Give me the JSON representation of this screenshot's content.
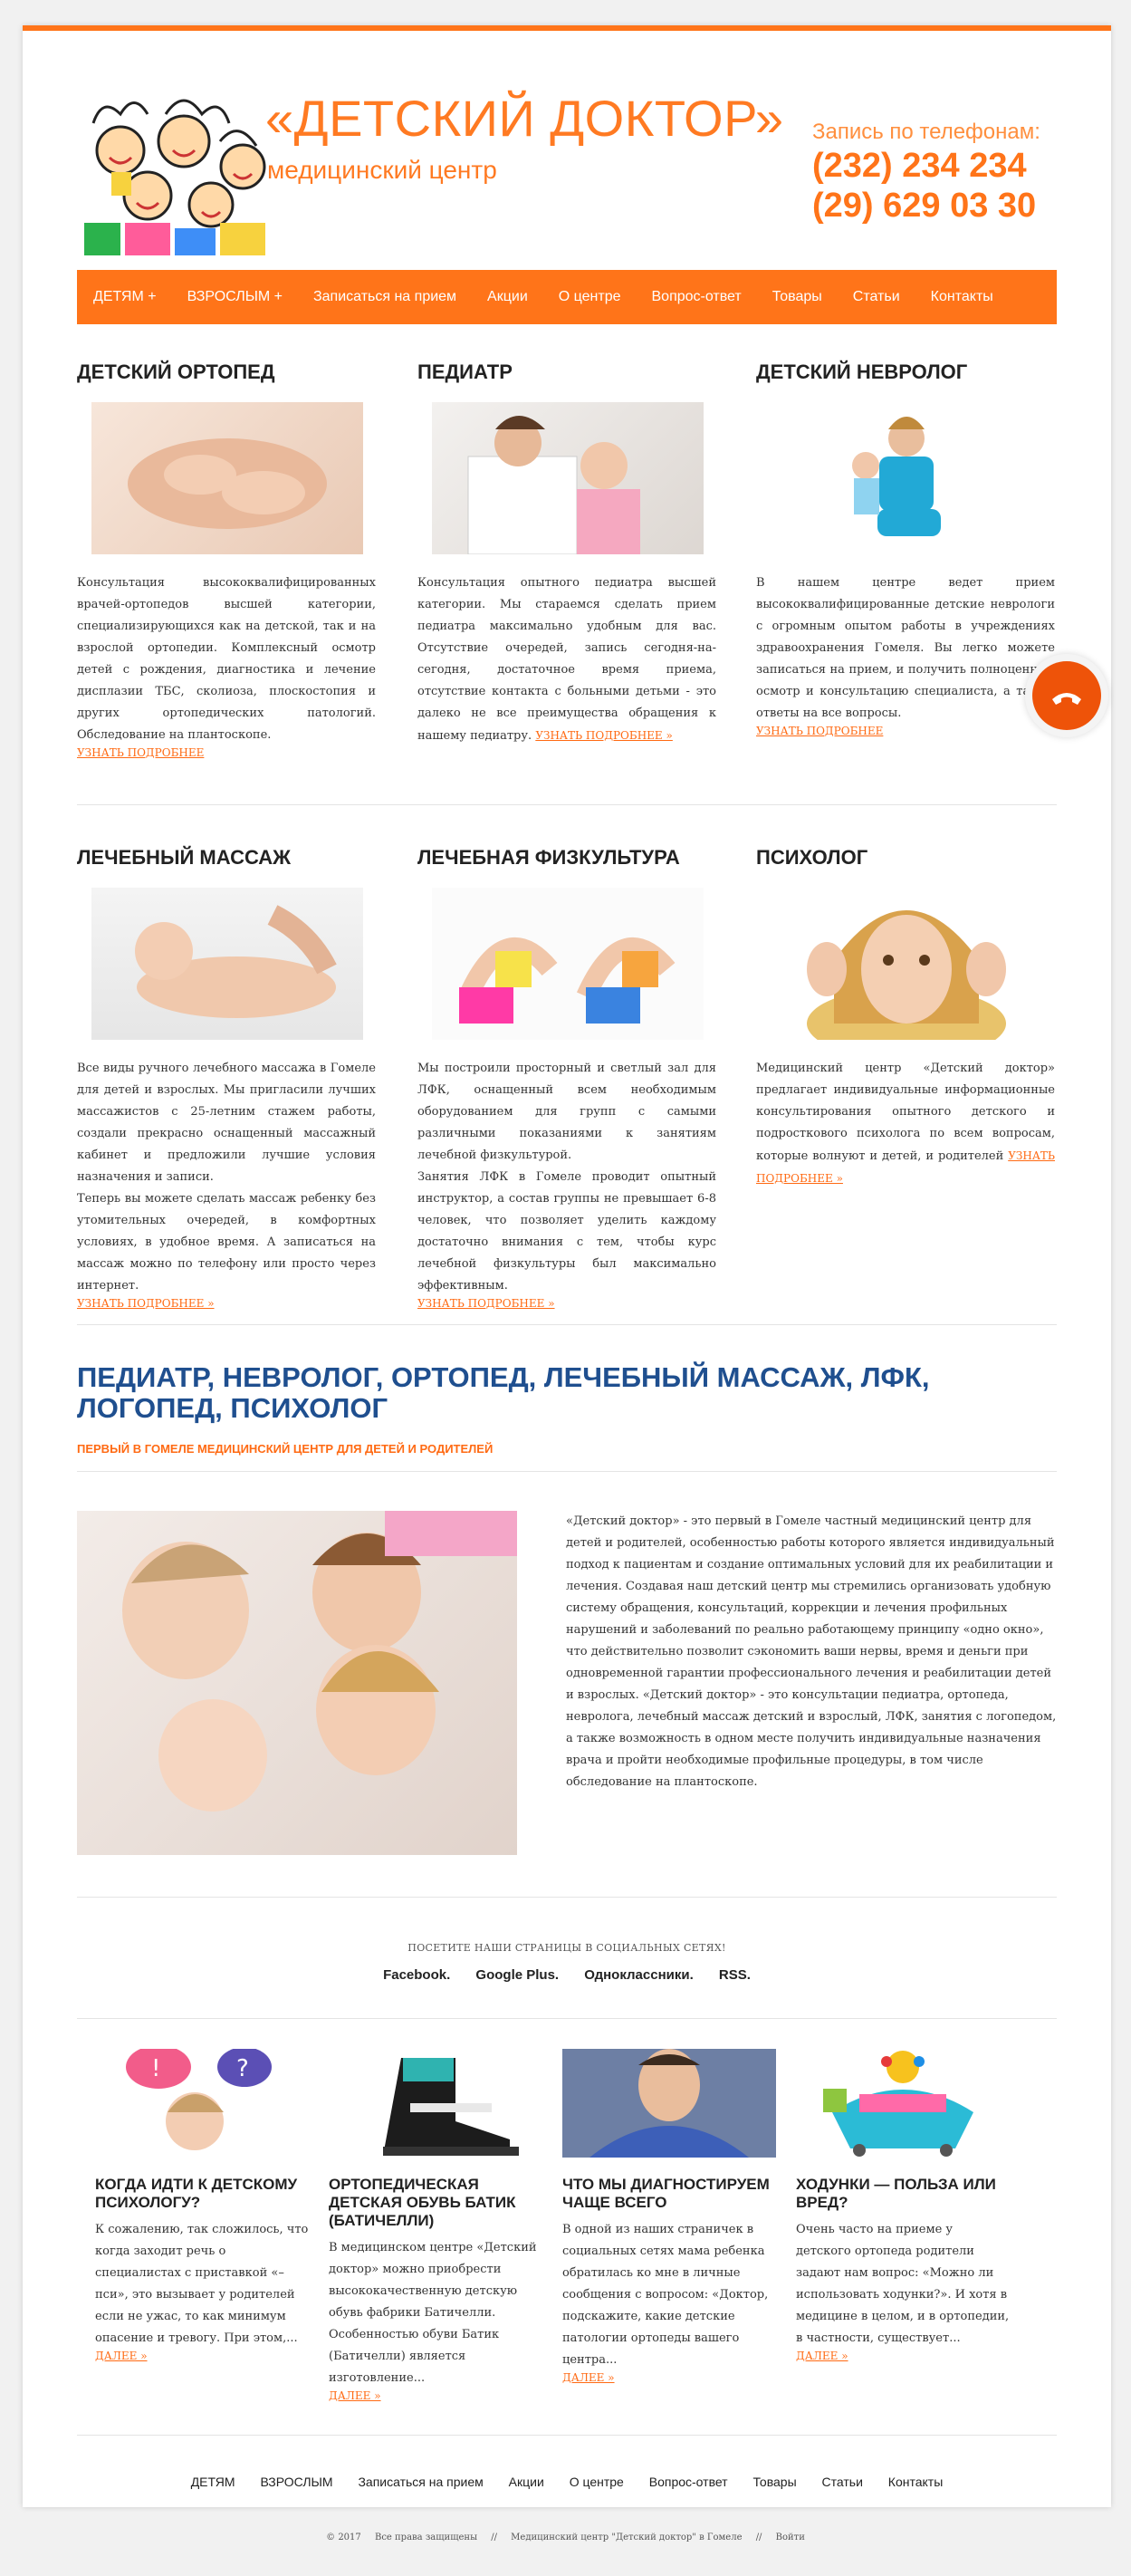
{
  "header": {
    "title": "«ДЕТСКИЙ ДОКТОР»",
    "subtitle": "медицинский центр",
    "phone_label": "Запись по телефонам:",
    "phone1": "(232) 234 234",
    "phone2": "(29) 629 03 30"
  },
  "nav": [
    "ДЕТЯМ +",
    "ВЗРОСЛЫМ +",
    "Записаться на прием",
    "Акции",
    "О центре",
    "Вопрос-ответ",
    "Товары",
    "Статьи",
    "Контакты"
  ],
  "services": [
    {
      "title": "ДЕТСКИЙ ОРТОПЕД",
      "text": "Консультация высококвалифицированных врачей-ортопедов высшей категории, специализирующихся как на детской, так и на взрослой ортопедии. Комплексный осмотр детей с рождения, диагностика и лечение дисплазии ТБС, сколиоза, плоскостопия и других ортопедических патологий. Обследование на плантоскопе.",
      "more": "УЗНАТЬ ПОДРОБНЕЕ"
    },
    {
      "title": "ПЕДИАТР",
      "text": "Консультация опытного педиатра высшей категории. Мы стараемся сделать прием педиатра максимально удобным для вас. Отсутствие очередей, запись сегодня-на-сегодня, достаточное время приема, отсутствие контакта с больными детьми - это далеко не все преимущества обращения к нашему педиатру.",
      "more": "УЗНАТЬ ПОДРОБНЕЕ »"
    },
    {
      "title": "ДЕТСКИЙ НЕВРОЛОГ",
      "text": "В нашем центре ведет прием высококвалифицированные детские неврологи с огромным опытом работы в учреждениях здравоохранения Гомеля. Вы легко можете записаться на прием, и получить полноценный осмотр и консультацию специалиста, а также ответы на все вопросы.",
      "more": "УЗНАТЬ ПОДРОБНЕЕ"
    },
    {
      "title": "ЛЕЧЕБНЫЙ МАССАЖ",
      "text": "Все виды ручного лечебного массажа в Гомеле для детей и взрослых. Мы пригласили лучших массажистов с 25-летним стажем работы, создали прекрасно оснащенный массажный кабинет и предложили лучшие условия назначения и записи.\nТеперь вы можете сделать массаж ребенку без утомительных очередей, в комфортных условиях, в удобное время. А записаться на массаж можно по телефону или просто через интернет.",
      "more": "УЗНАТЬ ПОДРОБНЕЕ »"
    },
    {
      "title": "ЛЕЧЕБНАЯ ФИЗКУЛЬТУРА",
      "text": "Мы построили просторный и светлый зал для ЛФК, оснащенный всем необходимым оборудованием для групп с самыми различными показаниями к занятиям лечебной физкультурой.\nЗанятия ЛФК в Гомеле проводит опытный инструктор, а состав группы не превышает 6-8 человек, что позволяет уделить каждому достаточно внимания с тем, чтобы курс лечебной физкультуры был максимально эффективным.",
      "more": "УЗНАТЬ ПОДРОБНЕЕ »"
    },
    {
      "title": "ПСИХОЛОГ",
      "text": "Медицинский центр «Детский доктор» предлагает индивидуальные информационные консультирования опытного детского и подросткового психолога по всем вопросам, которые волнуют и детей, и родителей",
      "more": "УЗНАТЬ ПОДРОБНЕЕ »"
    }
  ],
  "about": {
    "title": "ПЕДИАТР, НЕВРОЛОГ, ОРТОПЕД, ЛЕЧЕБНЫЙ МАССАЖ, ЛФК, ЛОГОПЕД, ПСИХОЛОГ",
    "subtitle": "ПЕРВЫЙ В ГОМЕЛЕ МЕДИЦИНСКИЙ ЦЕНТР ДЛЯ ДЕТЕЙ И РОДИТЕЛЕЙ",
    "text": "«Детский доктор» - это первый в Гомеле частный медицинский центр для детей и родителей, особенностью работы которого является индивидуальный подход к пациентам и создание оптимальных условий для их реабилитации и лечения. Создавая наш детский центр мы стремились организовать удобную систему обращения, консультаций, коррекции и лечения профильных нарушений и заболеваний по реально работающему принципу «одно окно», что действительно позволит сэкономить ваши нервы, время и деньги при одновременной гарантии профессионального лечения и реабилитации детей и взрослых. «Детский доктор» - это консультации педиатра, ортопеда, невролога, лечебный массаж детский и взрослый, ЛФК, занятия с логопедом, а также возможность в одном месте получить индивидуальные назначения врача и пройти необходимые профильные процедуры, в том числе обследование на плантоскопе."
  },
  "social": {
    "label": "ПОСЕТИТЕ НАШИ СТРАНИЦЫ В СОЦИАЛЬНЫХ СЕТЯХ!",
    "links": [
      "Facebook.",
      "Google Plus.",
      "Одноклассники.",
      "RSS."
    ]
  },
  "posts": [
    {
      "title": "КОГДА ИДТИ К ДЕТСКОМУ ПСИХОЛОГУ?",
      "text": "К сожалению, так сложилось, что когда заходит речь о специалистах с приставкой «–пси», это вызывает у родителей если не ужас, то как минимум опасение и тревогу. При этом,...",
      "more": "ДАЛЕЕ »"
    },
    {
      "title": "ОРТОПЕДИЧЕСКАЯ ДЕТСКАЯ ОБУВЬ БАТИК (БАТИЧЕЛЛИ)",
      "text": "В медицинском центре «Детский доктор» можно приобрести высококачественную детскую обувь фабрики Батичелли. Особенностью обуви Батик (Батичелли) является изготовление...",
      "more": "ДАЛЕЕ »"
    },
    {
      "title": "ЧТО МЫ ДИАГНОСТИРУЕМ ЧАЩЕ ВСЕГО",
      "text": "В одной из наших страничек в социальных сетях мама ребенка обратилась ко мне в личные сообщения с вопросом: «Доктор, подскажите, какие детские патологии ортопеды вашего центра...",
      "more": "ДАЛЕЕ »"
    },
    {
      "title": "ХОДУНКИ — ПОЛЬЗА ИЛИ ВРЕД?",
      "text": "Очень часто на приеме у детского ортопеда родители задают нам вопрос: «Можно ли использовать ходунки?». И хотя в медицине в целом, и в ортопедии, в частности, существует...",
      "more": "ДАЛЕЕ »"
    }
  ],
  "footer_nav": [
    "ДЕТЯМ",
    "ВЗРОСЛЫМ",
    "Записаться на прием",
    "Акции",
    "О центре",
    "Вопрос-ответ",
    "Товары",
    "Статьи",
    "Контакты"
  ],
  "copyright": {
    "year": "© 2017",
    "rights": "Все права защищены",
    "center": "Медицинский центр \"Детский доктор\" в Гомеле",
    "login": "Войти",
    "sep": "//"
  },
  "colors": {
    "accent": "#ff7419",
    "title_blue": "#1f4f8f",
    "call": "#ee5309"
  }
}
